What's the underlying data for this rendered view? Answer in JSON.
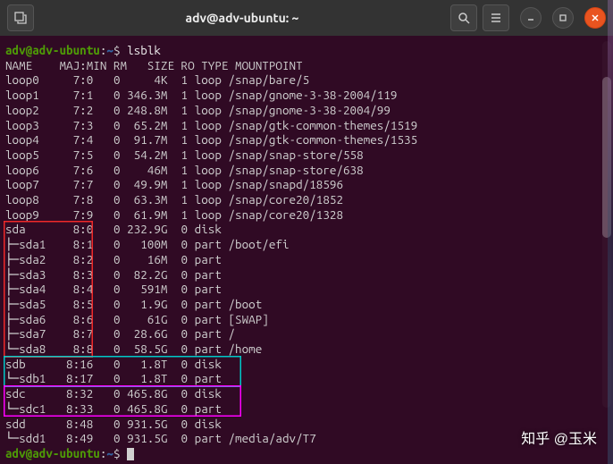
{
  "window": {
    "title": "adv@adv-ubuntu: ~"
  },
  "prompt": {
    "user_host": "adv@adv-ubuntu",
    "sep1": ":",
    "path": "~",
    "sep2": "$ "
  },
  "command": "lsblk",
  "header": "NAME    MAJ:MIN RM   SIZE RO TYPE MOUNTPOINT",
  "rows": [
    {
      "name": "loop0",
      "mm": "7:0",
      "rm": "0",
      "size": "4K",
      "ro": "1",
      "type": "loop",
      "mount": "/snap/bare/5"
    },
    {
      "name": "loop1",
      "mm": "7:1",
      "rm": "0",
      "size": "346.3M",
      "ro": "1",
      "type": "loop",
      "mount": "/snap/gnome-3-38-2004/119"
    },
    {
      "name": "loop2",
      "mm": "7:2",
      "rm": "0",
      "size": "248.8M",
      "ro": "1",
      "type": "loop",
      "mount": "/snap/gnome-3-38-2004/99"
    },
    {
      "name": "loop3",
      "mm": "7:3",
      "rm": "0",
      "size": "65.2M",
      "ro": "1",
      "type": "loop",
      "mount": "/snap/gtk-common-themes/1519"
    },
    {
      "name": "loop4",
      "mm": "7:4",
      "rm": "0",
      "size": "91.7M",
      "ro": "1",
      "type": "loop",
      "mount": "/snap/gtk-common-themes/1535"
    },
    {
      "name": "loop5",
      "mm": "7:5",
      "rm": "0",
      "size": "54.2M",
      "ro": "1",
      "type": "loop",
      "mount": "/snap/snap-store/558"
    },
    {
      "name": "loop6",
      "mm": "7:6",
      "rm": "0",
      "size": "46M",
      "ro": "1",
      "type": "loop",
      "mount": "/snap/snap-store/638"
    },
    {
      "name": "loop7",
      "mm": "7:7",
      "rm": "0",
      "size": "49.9M",
      "ro": "1",
      "type": "loop",
      "mount": "/snap/snapd/18596"
    },
    {
      "name": "loop8",
      "mm": "7:8",
      "rm": "0",
      "size": "63.3M",
      "ro": "1",
      "type": "loop",
      "mount": "/snap/core20/1852"
    },
    {
      "name": "loop9",
      "mm": "7:9",
      "rm": "0",
      "size": "61.9M",
      "ro": "1",
      "type": "loop",
      "mount": "/snap/core20/1328"
    },
    {
      "name": "sda",
      "mm": "8:0",
      "rm": "0",
      "size": "232.9G",
      "ro": "0",
      "type": "disk",
      "mount": ""
    },
    {
      "name": "├─sda1",
      "mm": "8:1",
      "rm": "0",
      "size": "100M",
      "ro": "0",
      "type": "part",
      "mount": "/boot/efi"
    },
    {
      "name": "├─sda2",
      "mm": "8:2",
      "rm": "0",
      "size": "16M",
      "ro": "0",
      "type": "part",
      "mount": ""
    },
    {
      "name": "├─sda3",
      "mm": "8:3",
      "rm": "0",
      "size": "82.2G",
      "ro": "0",
      "type": "part",
      "mount": ""
    },
    {
      "name": "├─sda4",
      "mm": "8:4",
      "rm": "0",
      "size": "591M",
      "ro": "0",
      "type": "part",
      "mount": ""
    },
    {
      "name": "├─sda5",
      "mm": "8:5",
      "rm": "0",
      "size": "1.9G",
      "ro": "0",
      "type": "part",
      "mount": "/boot"
    },
    {
      "name": "├─sda6",
      "mm": "8:6",
      "rm": "0",
      "size": "61G",
      "ro": "0",
      "type": "part",
      "mount": "[SWAP]"
    },
    {
      "name": "├─sda7",
      "mm": "8:7",
      "rm": "0",
      "size": "28.6G",
      "ro": "0",
      "type": "part",
      "mount": "/"
    },
    {
      "name": "└─sda8",
      "mm": "8:8",
      "rm": "0",
      "size": "58.5G",
      "ro": "0",
      "type": "part",
      "mount": "/home"
    },
    {
      "name": "sdb",
      "mm": "8:16",
      "rm": "0",
      "size": "1.8T",
      "ro": "0",
      "type": "disk",
      "mount": ""
    },
    {
      "name": "└─sdb1",
      "mm": "8:17",
      "rm": "0",
      "size": "1.8T",
      "ro": "0",
      "type": "part",
      "mount": ""
    },
    {
      "name": "sdc",
      "mm": "8:32",
      "rm": "0",
      "size": "465.8G",
      "ro": "0",
      "type": "disk",
      "mount": ""
    },
    {
      "name": "└─sdc1",
      "mm": "8:33",
      "rm": "0",
      "size": "465.8G",
      "ro": "0",
      "type": "part",
      "mount": ""
    },
    {
      "name": "sdd",
      "mm": "8:48",
      "rm": "0",
      "size": "931.5G",
      "ro": "0",
      "type": "disk",
      "mount": ""
    },
    {
      "name": "└─sdd1",
      "mm": "8:49",
      "rm": "0",
      "size": "931.5G",
      "ro": "0",
      "type": "part",
      "mount": "/media/adv/T7"
    }
  ],
  "watermark": "知乎 @玉米",
  "highlights": {
    "red": {
      "desc": "sda group columns 1-2",
      "top_row": 10,
      "rows": 9
    },
    "cyan": {
      "desc": "sdb group all columns",
      "top_row": 19,
      "rows": 2
    },
    "magenta": {
      "desc": "sdc group all columns",
      "top_row": 21,
      "rows": 2
    }
  }
}
